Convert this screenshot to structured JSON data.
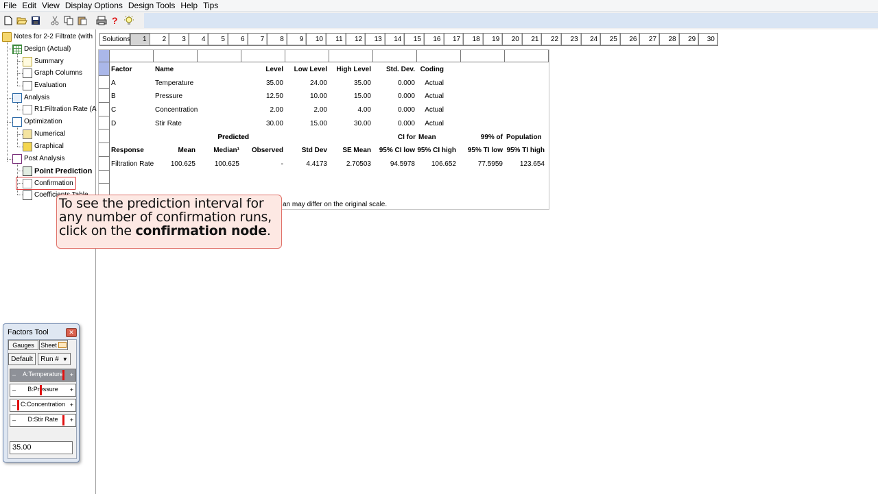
{
  "menubar": {
    "items": [
      "File",
      "Edit",
      "View",
      "Display Options",
      "Design Tools",
      "Help",
      "Tips"
    ]
  },
  "toolbar": {
    "buttons": [
      "new-icon",
      "open-icon",
      "save-icon",
      "cut-icon",
      "copy-icon",
      "paste-icon",
      "print-icon",
      "help-icon",
      "tips-icon"
    ]
  },
  "tree": {
    "root": "Notes for 2-2 Filtrate (with",
    "design": "Design (Actual)",
    "summary": "Summary",
    "graph_columns": "Graph Columns",
    "evaluation": "Evaluation",
    "analysis": "Analysis",
    "r1": "R1:Filtration Rate (A",
    "optimization": "Optimization",
    "numerical": "Numerical",
    "graphical": "Graphical",
    "post_analysis": "Post Analysis",
    "point_prediction": "Point Prediction",
    "confirmation": "Confirmation",
    "coefficients_table": "Coefficients Table"
  },
  "solutions": {
    "label": "Solutions",
    "tabs": [
      "1",
      "2",
      "3",
      "4",
      "5",
      "6",
      "7",
      "8",
      "9",
      "10",
      "11",
      "12",
      "13",
      "14",
      "15",
      "16",
      "17",
      "18",
      "19",
      "20",
      "21",
      "22",
      "23",
      "24",
      "25",
      "26",
      "27",
      "28",
      "29",
      "30"
    ],
    "active": "1"
  },
  "grid": {
    "factor_headers": [
      "Factor",
      "Name",
      "Level",
      "Low Level",
      "High Level",
      "Std. Dev.",
      "Coding"
    ],
    "factors": [
      [
        "A",
        "Temperature",
        "35.00",
        "24.00",
        "35.00",
        "0.000",
        "Actual"
      ],
      [
        "B",
        "Pressure",
        "12.50",
        "10.00",
        "15.00",
        "0.000",
        "Actual"
      ],
      [
        "C",
        "Concentration",
        "2.00",
        "2.00",
        "4.00",
        "0.000",
        "Actual"
      ],
      [
        "D",
        "Stir Rate",
        "30.00",
        "15.00",
        "30.00",
        "0.000",
        "Actual"
      ]
    ],
    "resp_header_top": [
      "Predicted",
      "Predicted",
      "CI for",
      "Mean",
      "99% of",
      "Population"
    ],
    "resp_header_bottom": [
      "Response",
      "Mean",
      "Median¹",
      "Observed",
      "Std Dev",
      "SE Mean",
      "95% CI low",
      "95% CI high",
      "95% TI low",
      "95% TI high"
    ],
    "response_row": [
      "Filtration Rate",
      "100.625",
      "100.625",
      "-",
      "4.4173",
      "2.70503",
      "94.5978",
      "106.652",
      "77.5959",
      "123.654"
    ],
    "footnote": "1 Predicted mean and median may differ on the original scale."
  },
  "callout": {
    "line1": "To see the prediction interval for",
    "line2": "any number of confirmation runs,",
    "line3_prefix": "click on the ",
    "line3_bold": "confirmation node",
    "line3_suffix": "."
  },
  "factors_tool": {
    "title": "Factors Tool",
    "tab_gauges": "Gauges",
    "tab_sheet": "Sheet",
    "default_btn": "Default",
    "run_select": "Run #",
    "gauges": [
      {
        "label": "A:Temperature",
        "level": 1.0
      },
      {
        "label": "B:Pressure",
        "level": 0.5
      },
      {
        "label": "C:Concentration",
        "level": 0.0
      },
      {
        "label": "D:Stir Rate",
        "level": 1.0
      }
    ],
    "value": "35.00"
  }
}
